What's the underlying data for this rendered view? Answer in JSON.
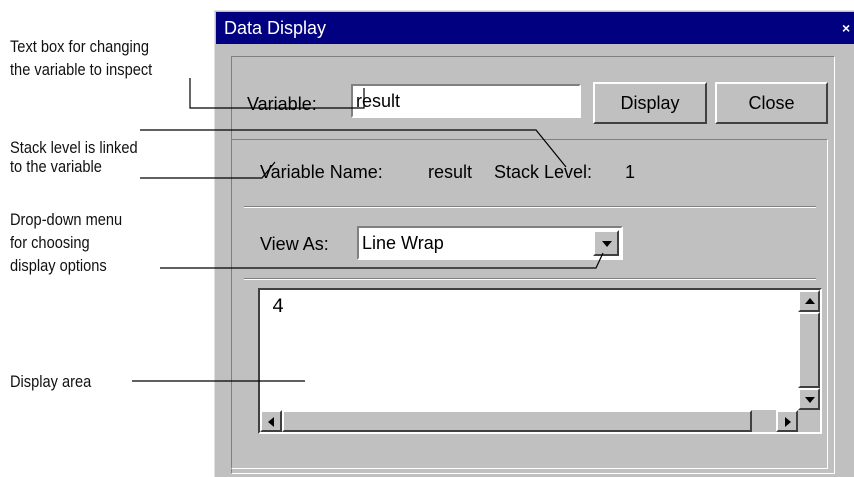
{
  "callouts": {
    "text_box": [
      "Text box for changing",
      "the variable to inspect"
    ],
    "stack_level": [
      "Stack level is linked",
      "to the variable"
    ],
    "drop_down": [
      "Drop-down menu",
      "for choosing",
      "display options"
    ],
    "display_area": "Display area"
  },
  "window": {
    "title": "Data Display",
    "close_glyph": "×"
  },
  "variable_row": {
    "label": "Variable:",
    "value": "result",
    "display_button": "Display",
    "close_button": "Close"
  },
  "info_row": {
    "name_label": "Variable Name:",
    "name_value": "result",
    "stack_label": "Stack Level:",
    "stack_value": "1"
  },
  "view_as": {
    "label": "View As:",
    "selected": "Line Wrap"
  },
  "display_area": {
    "content": "4"
  },
  "icons": [
    "close-icon",
    "chevron-down-icon",
    "scroll-up-icon",
    "scroll-down-icon",
    "scroll-left-icon",
    "scroll-right-icon"
  ],
  "colors": {
    "titlebar": "#000080",
    "face": "#c0c0c0"
  }
}
